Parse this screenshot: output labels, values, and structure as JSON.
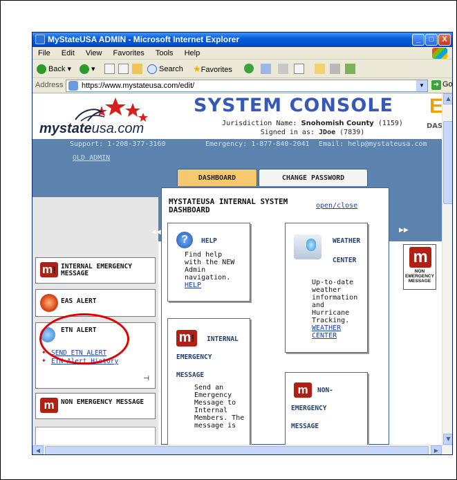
{
  "window": {
    "title": "MyStateUSA ADMIN - Microsoft Internet Explorer",
    "min_glyph": "_",
    "max_glyph": "□",
    "close_glyph": "X"
  },
  "menu": [
    "File",
    "Edit",
    "View",
    "Favorites",
    "Tools",
    "Help"
  ],
  "toolbar": {
    "back": "Back",
    "search": "Search",
    "favorites": "Favorites"
  },
  "address": {
    "label": "Address",
    "url": "https://www.mystateusa.com/edit/",
    "go": "Go"
  },
  "header": {
    "logo_bold": "mystate",
    "logo_rest": "usa.com",
    "console_title": "SYSTEM CONSOLE",
    "juris_label": "Jurisdiction Name:",
    "juris_name": "Snohomish County",
    "juris_id": "(1159)",
    "signed_label": "Signed in as:",
    "signed_user": "JDoe",
    "signed_id": "(7839)",
    "right_partial_letter": "E",
    "right_partial_text": "DASH"
  },
  "contact": {
    "support": "Support: 1-208-377-3160",
    "emergency": "Emergency: 1-877-840-2041",
    "email": "Email: help@mystateusa.com"
  },
  "nav": {
    "old_admin": "OLD ADMIN",
    "tab_dashboard": "DASHBOARD",
    "tab_change_password": "CHANGE PASSWORD"
  },
  "sidebar": {
    "internal_emergency": "INTERNAL EMERGENCY MESSAGE",
    "eas_alert": "EAS ALERT",
    "etn_alert": "ETN ALERT",
    "send_etn": "SEND ETN ALERT",
    "etn_history": "ETN Alert History",
    "non_emergency": "NON EMERGENCY MESSAGE"
  },
  "main": {
    "title": "MYSTATEUSA INTERNAL SYSTEM DASHBOARD",
    "open_close": "open/close",
    "help": {
      "title": "HELP",
      "body": "Find help with the NEW Admin navigation.",
      "link": "HELP"
    },
    "weather": {
      "title1": "WEATHER",
      "title2": "CENTER",
      "body": "Up-to-date weather information and Hurricane Tracking.",
      "link": "WEATHER CENTER"
    },
    "internal": {
      "title1": "INTERNAL",
      "title2": "EMERGENCY",
      "title3": "MESSAGE",
      "body": "Send an Emergency Message to Internal Members. The message is"
    },
    "nonemer": {
      "title1": "NON-",
      "title2": "EMERGENCY",
      "title3": "MESSAGE"
    }
  },
  "right_widget": {
    "label": "NON EMERGENCY MESSAGE"
  },
  "colors": {
    "titlebar": "#0a5fd8",
    "banner_blue": "#5b83ad",
    "dashboard_tab": "#f6c86f",
    "brand_red": "#b02014",
    "annotation_circle": "#e00000"
  }
}
